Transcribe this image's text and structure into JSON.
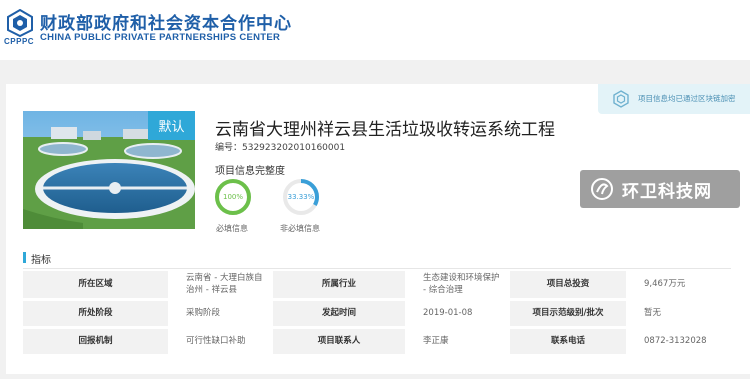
{
  "header": {
    "logo_abbr": "CPPPC",
    "org_name_cn": "财政部政府和社会资本合作中心",
    "org_name_en": "CHINA PUBLIC PRIVATE PARTNERSHIPS CENTER",
    "brand_color": "#1f5fa8"
  },
  "banner": {
    "text": "项目信息均已通过区块链加密",
    "icon": "blockchain-icon"
  },
  "project": {
    "image_badge": "默认",
    "title": "云南省大理州祥云县生活垃圾收转运系统工程",
    "code": "编号：53292320201016000​1",
    "completeness_label": "项目信息完整度",
    "required": {
      "value": "100%",
      "fraction": 1.0,
      "caption": "必填信息",
      "color": "#6cc04a"
    },
    "optional": {
      "value": "33.33%",
      "fraction": 0.3333,
      "caption": "非必填信息",
      "color": "#3a9fd8"
    }
  },
  "watermark": {
    "text": "环卫科技网",
    "icon": "watermark-logo-icon"
  },
  "indicators": {
    "section_title": "指标",
    "rows": [
      [
        {
          "key": "所在区域",
          "value": "云南省 - 大理白族自治州 - 祥云县"
        },
        {
          "key": "所属行业",
          "value": "生态建设和环境保护 - 综合治理"
        },
        {
          "key": "项目总投资",
          "value": "9,467万元"
        }
      ],
      [
        {
          "key": "所处阶段",
          "value": "采购阶段"
        },
        {
          "key": "发起时间",
          "value": "2019-01-08"
        },
        {
          "key": "项目示范级别/批次",
          "value": "暂无"
        }
      ],
      [
        {
          "key": "回报机制",
          "value": "可行性缺口补助"
        },
        {
          "key": "项目联系人",
          "value": "李正康"
        },
        {
          "key": "联系电话",
          "value": "0872-3132028"
        }
      ]
    ]
  },
  "accent_color": "#2fa8d8"
}
